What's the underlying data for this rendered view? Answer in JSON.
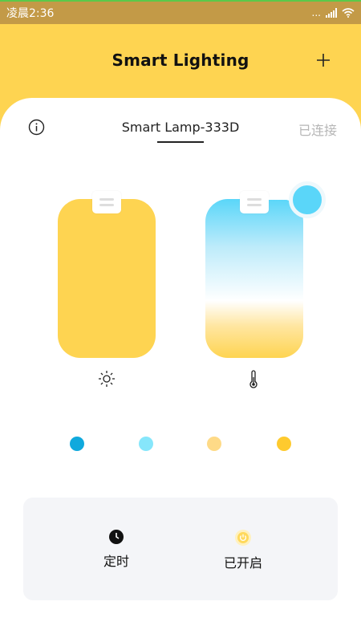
{
  "status_bar": {
    "time": "凌晨2:36",
    "dots": "..."
  },
  "header": {
    "title": "Smart Lighting"
  },
  "device": {
    "name": "Smart Lamp-333D",
    "connection_status": "已连接"
  },
  "sliders": {
    "brightness_level": 1.0,
    "temperature_level": 0.0
  },
  "presets": [
    {
      "color": "#10A9DD"
    },
    {
      "color": "#86E6FB"
    },
    {
      "color": "#FEDA87"
    },
    {
      "color": "#FECA2E"
    }
  ],
  "controls": {
    "timer_label": "定时",
    "power_label": "已开启"
  },
  "colors": {
    "accent": "#FED451",
    "cool": "#5AD6F9",
    "panel": "#F4F5F8"
  },
  "icons": [
    "plus-icon",
    "info-icon",
    "sun-icon",
    "thermometer-icon",
    "clock-icon",
    "power-icon",
    "wifi-icon",
    "signal-icon"
  ]
}
